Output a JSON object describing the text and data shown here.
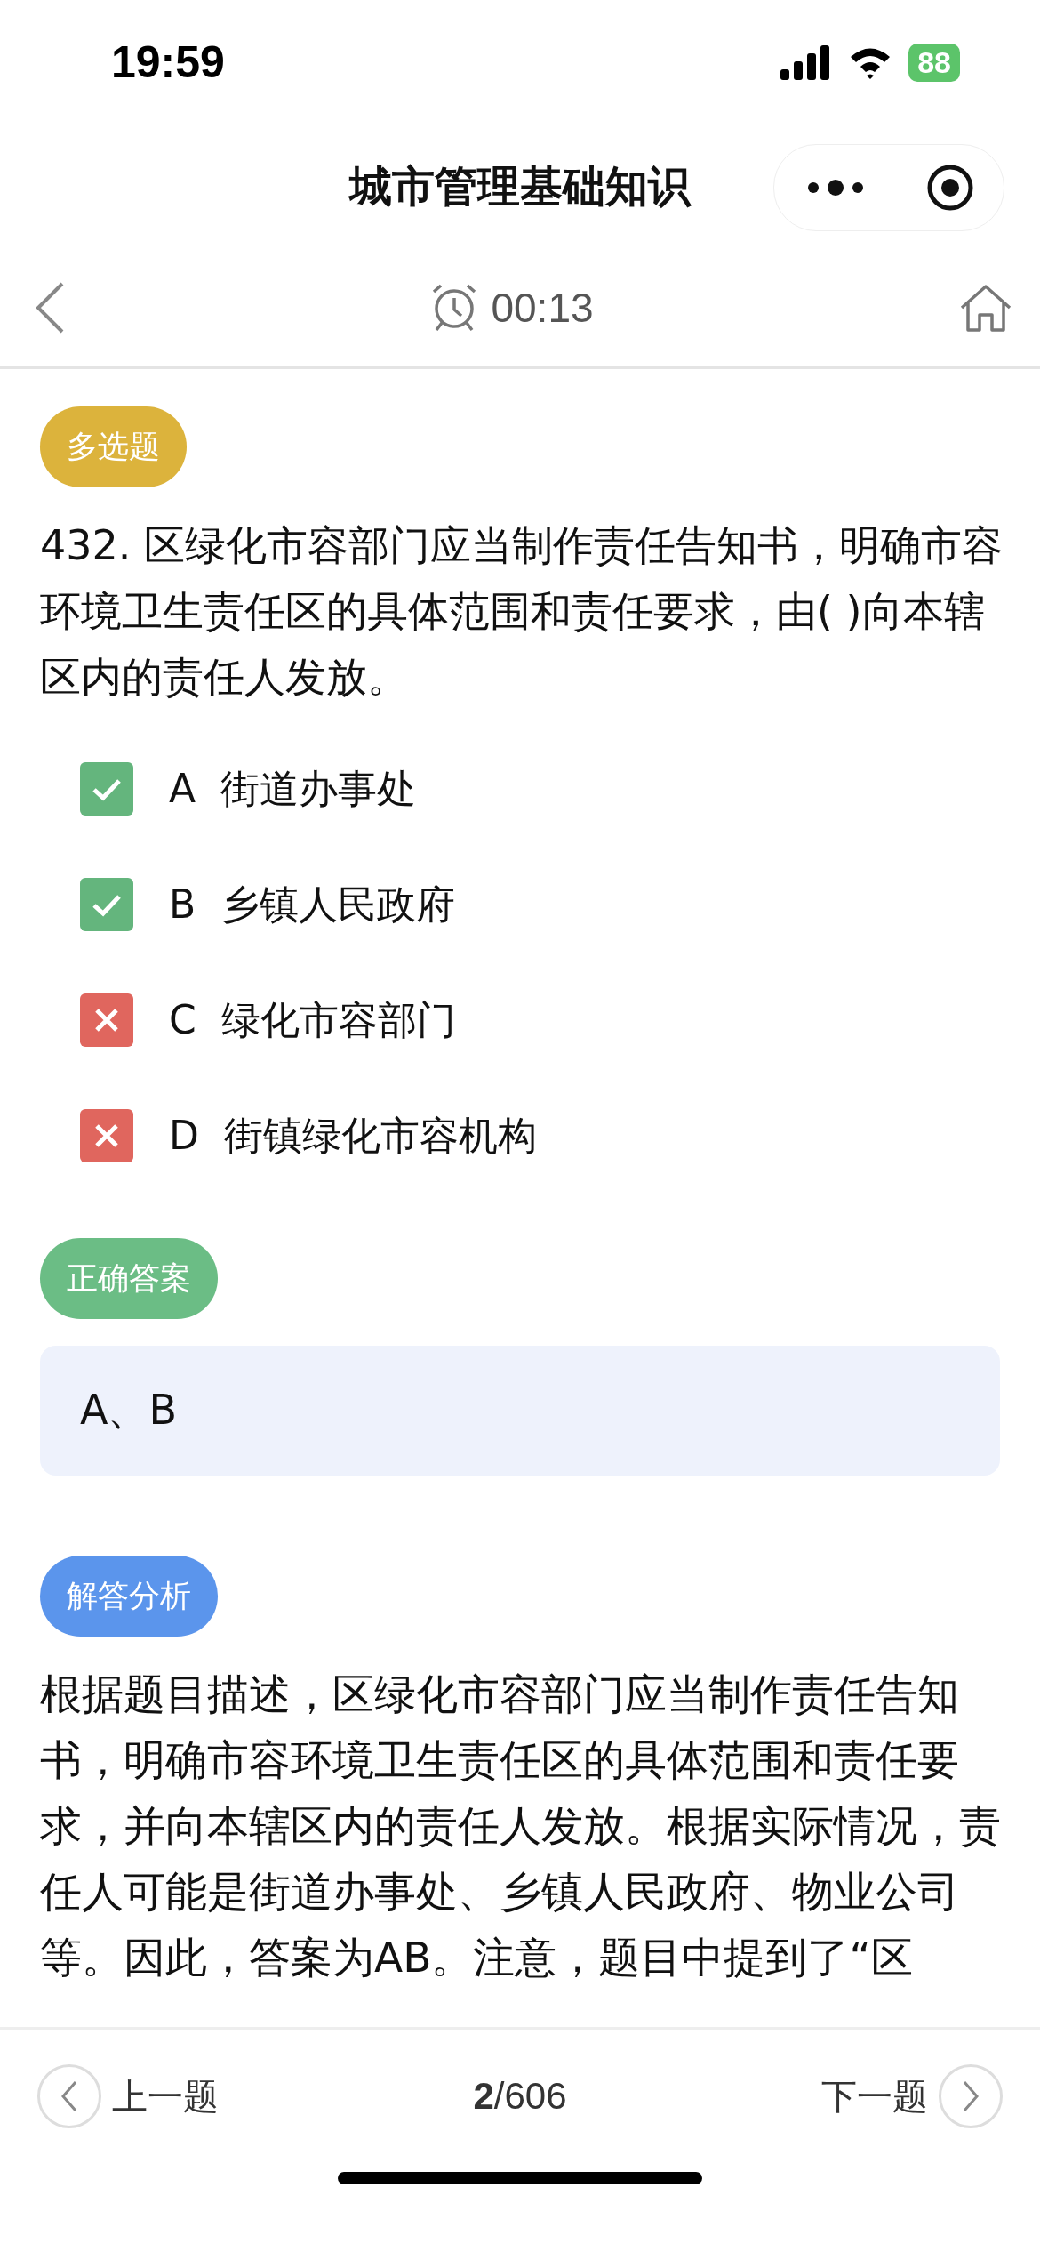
{
  "status_bar": {
    "time": "19:59",
    "battery": "88"
  },
  "nav": {
    "title": "城市管理基础知识"
  },
  "sub_bar": {
    "timer": "00:13"
  },
  "question": {
    "type_tag": "多选题",
    "text": "432. 区绿化市容部门应当制作责任告知书，明确市容环境卫生责任区的具体范围和责任要求，由( )向本辖区内的责任人发放。",
    "options": [
      {
        "letter": "A",
        "text": "街道办事处",
        "kind": "correct"
      },
      {
        "letter": "B",
        "text": "乡镇人民政府",
        "kind": "correct"
      },
      {
        "letter": "C",
        "text": "绿化市容部门",
        "kind": "wrong"
      },
      {
        "letter": "D",
        "text": "街镇绿化市容机构",
        "kind": "wrong"
      }
    ]
  },
  "answer": {
    "tag": "正确答案",
    "value": "A、B"
  },
  "analysis": {
    "tag": "解答分析",
    "text": "根据题目描述，区绿化市容部门应当制作责任告知书，明确市容环境卫生责任区的具体范围和责任要求，并向本辖区内的责任人发放。根据实际情况，责任人可能是街道办事处、乡镇人民政府、物业公司等。因此，答案为AB。注意，题目中提到了“区"
  },
  "footer": {
    "prev": "上一题",
    "page": "**2**/606",
    "next": "下一题"
  }
}
